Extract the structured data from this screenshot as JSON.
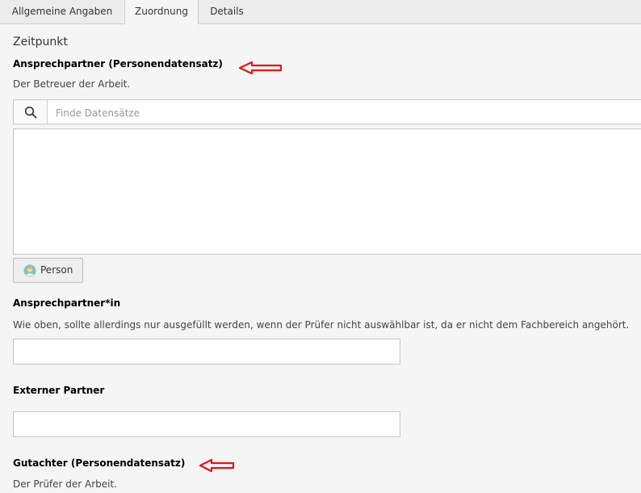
{
  "tabs": [
    {
      "label": "Allgemeine Angaben",
      "active": false
    },
    {
      "label": "Zuordnung",
      "active": true
    },
    {
      "label": "Details",
      "active": false
    }
  ],
  "section": {
    "title": "Zeitpunkt"
  },
  "fields": {
    "ansprechpartner": {
      "label": "Ansprechpartner (Personendatensatz)",
      "description": "Der Betreuer der Arbeit.",
      "search_placeholder": "Finde Datensätze",
      "add_button_label": "Person"
    },
    "ansprechpartner_in": {
      "label": "Ansprechpartner*in",
      "description": "Wie oben, sollte allerdings nur ausgefüllt werden, wenn der Prüfer nicht auswählbar ist, da er nicht dem Fachbereich angehört.",
      "value": ""
    },
    "externer_partner": {
      "label": "Externer Partner",
      "value": ""
    },
    "gutachter": {
      "label": "Gutachter (Personendatensatz)",
      "description": "Der Prüfer der Arbeit."
    }
  },
  "colors": {
    "annotation_arrow": "#e0161b",
    "tab_active_bg": "#f5f5f5",
    "page_bg": "#f5f5f5"
  },
  "icons": [
    "search-icon",
    "person-avatar-icon",
    "red-arrow-icon"
  ]
}
